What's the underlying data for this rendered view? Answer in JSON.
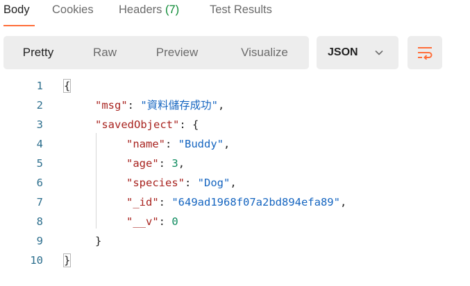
{
  "tabs": [
    {
      "label": "Body",
      "active": true
    },
    {
      "label": "Cookies",
      "active": false
    },
    {
      "label": "Headers",
      "count": "(7)",
      "active": false
    },
    {
      "label": "Test Results",
      "active": false
    }
  ],
  "view_modes": [
    "Pretty",
    "Raw",
    "Preview",
    "Visualize"
  ],
  "active_view_mode": "Pretty",
  "format_select": {
    "value": "JSON"
  },
  "colors": {
    "accent": "#ff6c37",
    "key": "#a8231f",
    "string": "#1565c0",
    "number": "#0b8a5d",
    "line_number": "#2c6e8d",
    "count": "#0c8a34"
  },
  "code": {
    "line_numbers": [
      "1",
      "2",
      "3",
      "4",
      "5",
      "6",
      "7",
      "8",
      "9",
      "10"
    ],
    "open_brace": "{",
    "close_brace": "}",
    "msg_key": "\"msg\"",
    "msg_value": "\"資料儲存成功\"",
    "saved_key": "\"savedObject\"",
    "name_key": "\"name\"",
    "name_value": "\"Buddy\"",
    "age_key": "\"age\"",
    "age_value": "3",
    "species_key": "\"species\"",
    "species_value": "\"Dog\"",
    "id_key": "\"_id\"",
    "id_value": "\"649ad1968f07a2bd894efa89\"",
    "v_key": "\"__v\"",
    "v_value": "0"
  }
}
